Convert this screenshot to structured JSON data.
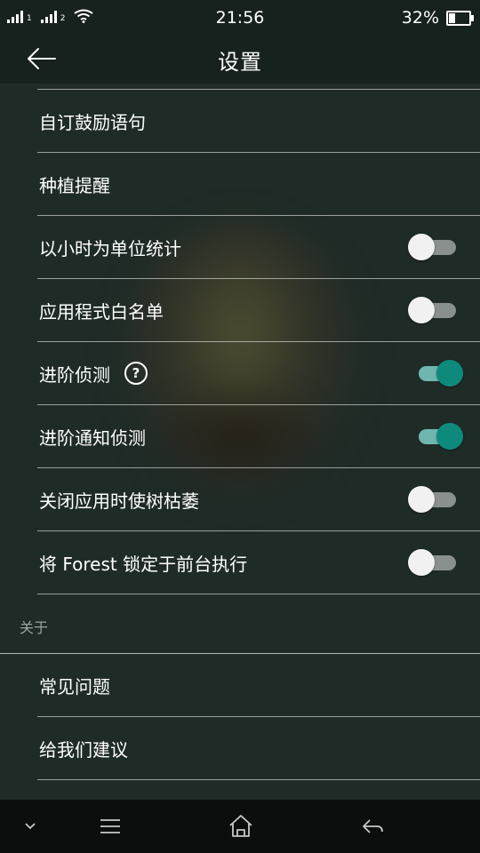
{
  "status_bar": {
    "signal1_label": "1",
    "signal2_label": "2",
    "time": "21:56",
    "battery_percent": "32%",
    "battery_level": 0.32
  },
  "header": {
    "title": "设置",
    "back_icon": "arrow-left-icon"
  },
  "settings": {
    "items": [
      {
        "label": "自订鼓励语句"
      },
      {
        "label": "种植提醒"
      },
      {
        "label": "以小时为单位统计",
        "toggle": false
      },
      {
        "label": "应用程式白名单",
        "toggle": false
      },
      {
        "label": "进阶侦测",
        "help": "?",
        "toggle": true
      },
      {
        "label": "进阶通知侦测",
        "toggle": true
      },
      {
        "label": "关闭应用时使树枯萎",
        "toggle": false
      },
      {
        "label": "将 Forest 锁定于前台执行",
        "toggle": false
      }
    ]
  },
  "about": {
    "header": "关于",
    "items": [
      {
        "label": "常见问题"
      },
      {
        "label": "给我们建议"
      }
    ]
  },
  "nav_bar": {
    "icons": [
      "chevron-down-icon",
      "menu-icon",
      "home-icon",
      "back-icon"
    ]
  },
  "colors": {
    "background": "#1f2b27",
    "toggle_on": "#0e8a7c",
    "toggle_off_knob": "#f1f1f1"
  }
}
